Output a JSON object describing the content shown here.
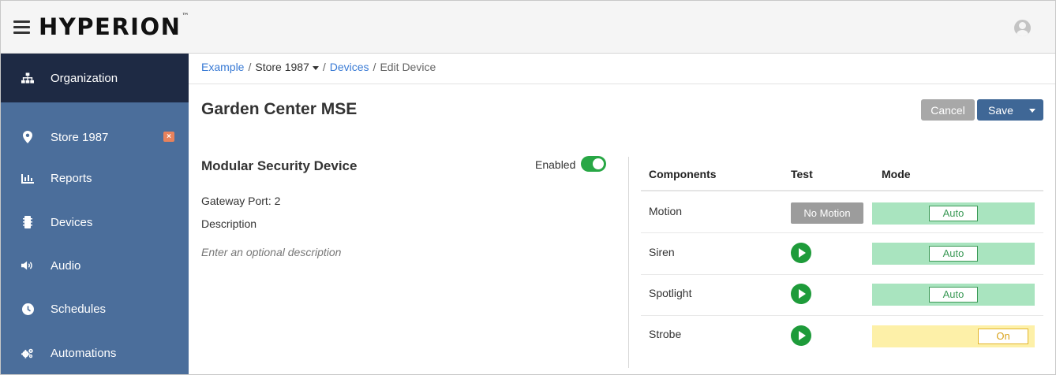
{
  "app": {
    "logo": "HYPERION",
    "trademark": "™"
  },
  "sidebar": {
    "items": [
      {
        "label": "Organization",
        "icon": "sitemap-icon"
      },
      {
        "label": "Store 1987",
        "icon": "map-marker-icon"
      },
      {
        "label": "Reports",
        "icon": "bar-chart-icon"
      },
      {
        "label": "Devices",
        "icon": "chip-icon"
      },
      {
        "label": "Audio",
        "icon": "speaker-icon"
      },
      {
        "label": "Schedules",
        "icon": "clock-icon"
      },
      {
        "label": "Automations",
        "icon": "gears-icon"
      }
    ],
    "close_glyph": "×"
  },
  "breadcrumb": {
    "org": "Example",
    "store": "Store 1987",
    "devices": "Devices",
    "current": "Edit Device",
    "separator": "/"
  },
  "page": {
    "title": "Garden Center MSE"
  },
  "toolbar": {
    "cancel_label": "Cancel",
    "save_label": "Save"
  },
  "device": {
    "type": "Modular Security Device",
    "enabled_label": "Enabled",
    "enabled": true,
    "gateway": "Gateway Port: 2",
    "description_label": "Description",
    "description_placeholder": "Enter an optional description"
  },
  "components_table": {
    "headers": {
      "components": "Components",
      "test": "Test",
      "mode": "Mode"
    },
    "rows": [
      {
        "name": "Motion",
        "test": "No Motion",
        "mode": "Auto"
      },
      {
        "name": "Siren",
        "test": "play",
        "mode": "Auto"
      },
      {
        "name": "Spotlight",
        "test": "play",
        "mode": "Auto"
      },
      {
        "name": "Strobe",
        "test": "play",
        "mode": "On"
      }
    ]
  },
  "colors": {
    "sidebar": "#4b6e9b",
    "sidebar_active": "#1e2a44",
    "accent_link": "#3a7bd5",
    "toggle_on": "#28a745",
    "play": "#1e9b3a",
    "mode_auto": "#a9e4bf",
    "mode_on": "#fdf0a8",
    "save": "#3f6796",
    "cancel": "#a8a8a8"
  }
}
